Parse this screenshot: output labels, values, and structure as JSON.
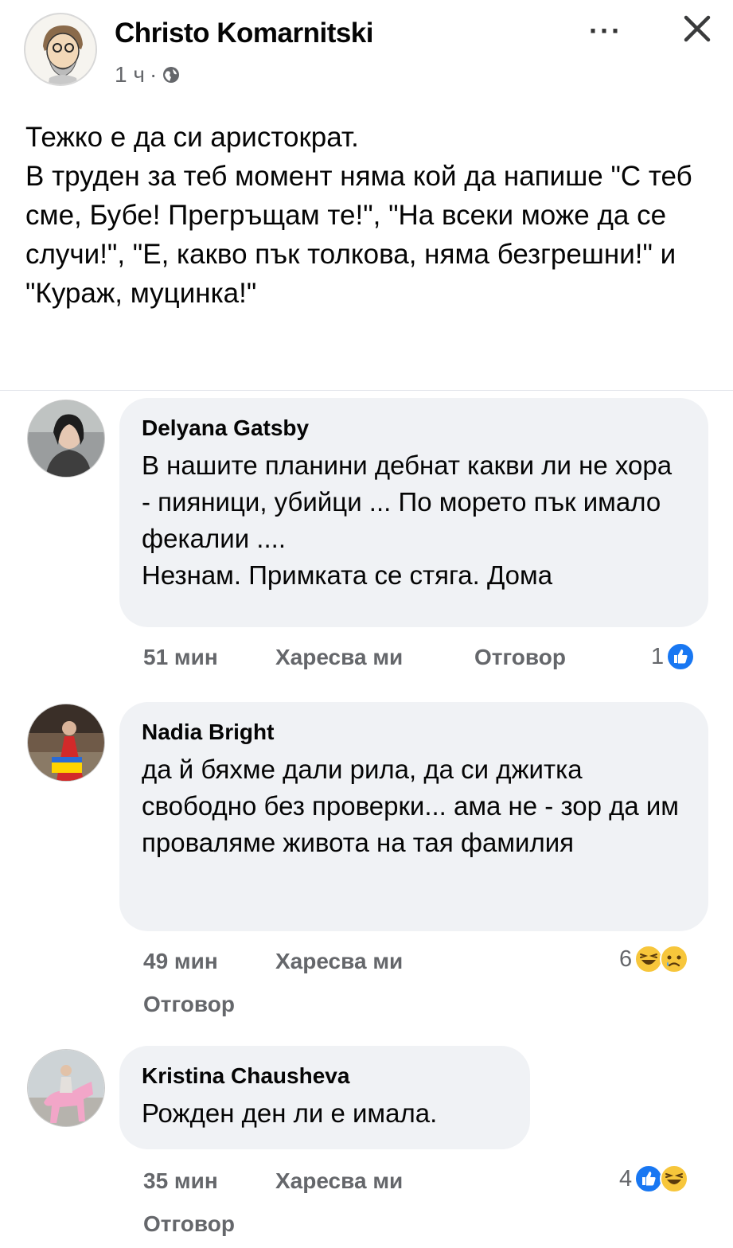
{
  "post": {
    "author": "Christo Komarnitski",
    "time": "1 ч",
    "separator": "·",
    "privacy_icon": "globe-icon",
    "more_label": "···",
    "text": "Тежко е да си аристократ.\nВ труден за теб момент няма кой да напише \"С теб сме, Бубе! Прегръщам те!\", \"На всеки може да се случи!\", \"Е, какво пък толкова, няма безгрешни!\" и \"Кураж, муцинка!\""
  },
  "comments": [
    {
      "author": "Delyana Gatsby",
      "text": "В нашите планини дебнат какви ли не хора - пияници, убийци ... По морето пък имало фекалии ....\nНезнам. Примката се стяга. Дома",
      "time": "51 мин",
      "like": "Харесва ми",
      "reply": "Отговор",
      "reaction_count": "1",
      "reactions": [
        "like-icon"
      ]
    },
    {
      "author": "Nadia Bright",
      "text": "да й бяхме дали рила, да си джитка свободно без проверки... ама не - зор да им проваляме живота на тая фамилия",
      "time": "49 мин",
      "like": "Харесва ми",
      "reply": "Отговор",
      "reaction_count": "6",
      "reactions": [
        "haha-icon",
        "sad-icon"
      ]
    },
    {
      "author": "Kristina Chausheva",
      "text": "Рожден ден ли е имала.",
      "time": "35 мин",
      "like": "Харесва ми",
      "reply": "Отговор",
      "reaction_count": "4",
      "reactions": [
        "like-icon",
        "haha-icon"
      ]
    }
  ],
  "colors": {
    "text": "#050505",
    "secondary": "#65676b",
    "bubble": "#f0f2f5",
    "like_blue": "#1877f2",
    "emoji_yellow": "#f7c63b"
  }
}
